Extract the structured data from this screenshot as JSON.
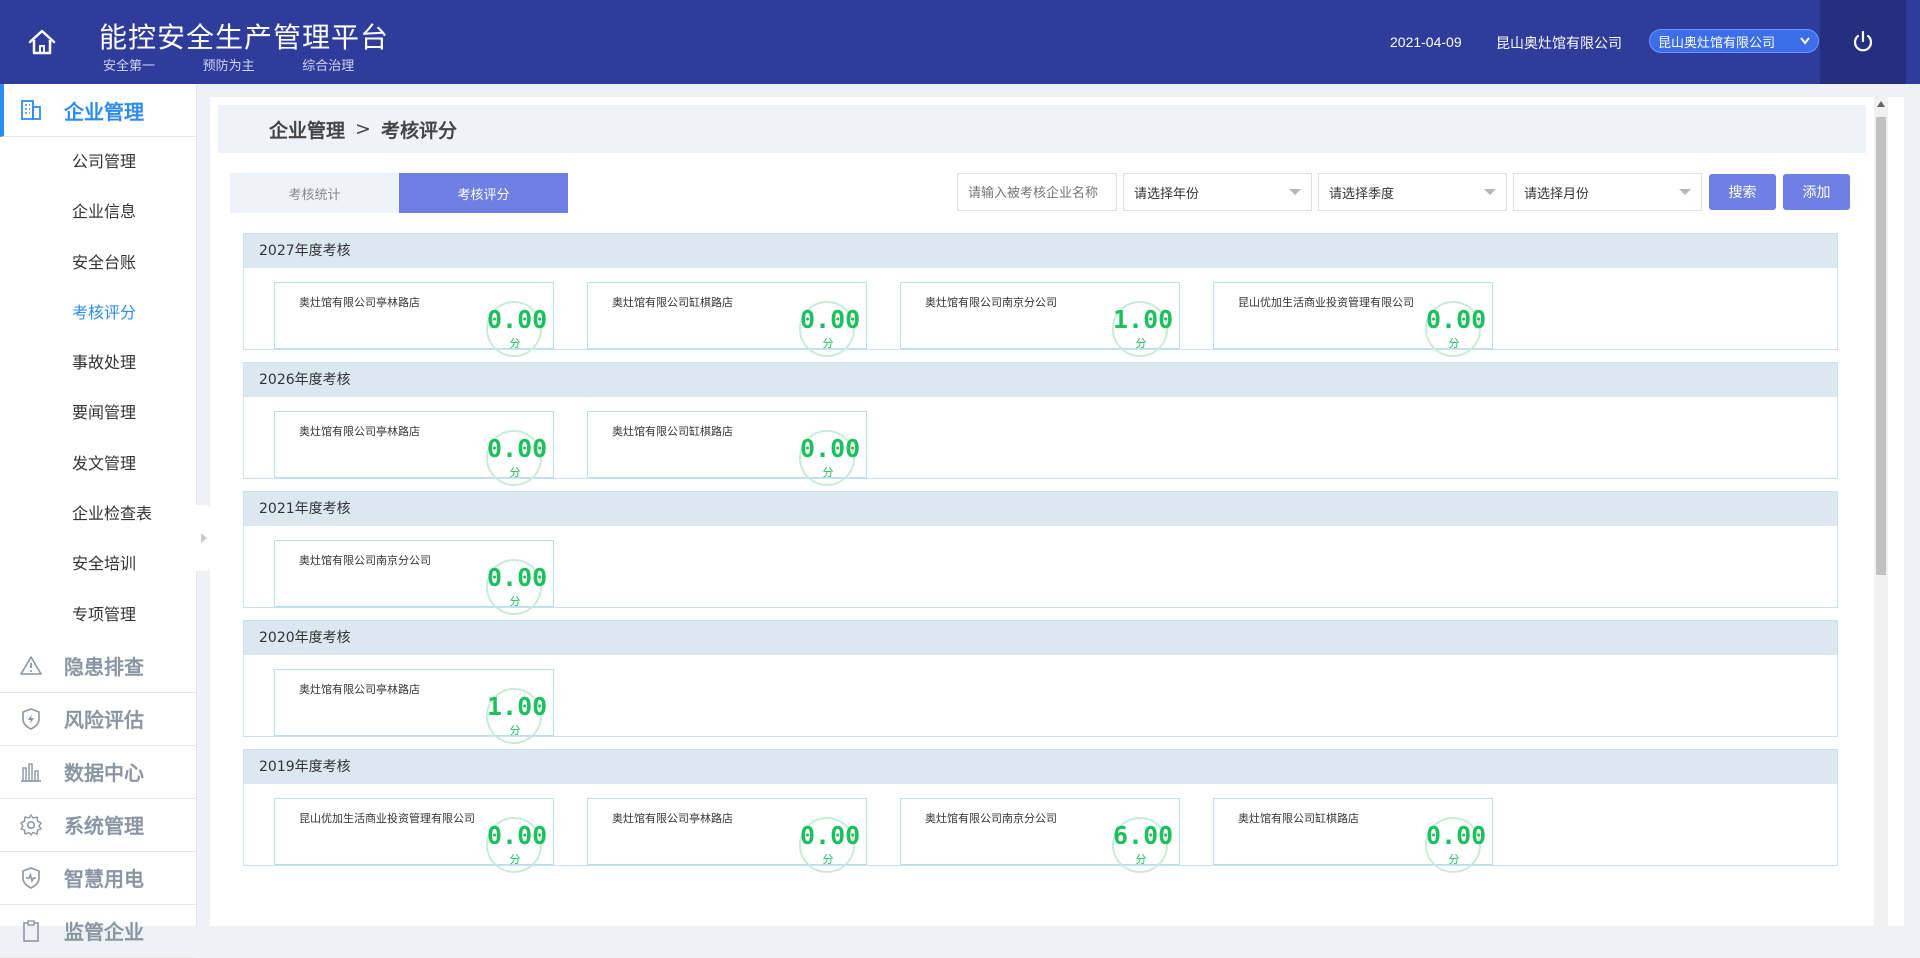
{
  "header": {
    "title": "能控安全生产管理平台",
    "slogans": [
      "安全第一",
      "预防为主",
      "综合治理"
    ],
    "date": "2021-04-09",
    "company": "昆山奥灶馆有限公司",
    "company_select": "昆山奥灶馆有限公司"
  },
  "sidebar": {
    "active_group": {
      "label": "企业管理",
      "icon": "building-icon"
    },
    "sub_items": [
      {
        "label": "公司管理"
      },
      {
        "label": "企业信息"
      },
      {
        "label": "安全台账"
      },
      {
        "label": "考核评分"
      },
      {
        "label": "事故处理"
      },
      {
        "label": "要闻管理"
      },
      {
        "label": "发文管理"
      },
      {
        "label": "企业检查表"
      },
      {
        "label": "安全培训"
      },
      {
        "label": "专项管理"
      }
    ],
    "groups": [
      {
        "label": "隐患排查",
        "icon": "warning-icon"
      },
      {
        "label": "风险评估",
        "icon": "shield-bolt-icon"
      },
      {
        "label": "数据中心",
        "icon": "bar-chart-icon"
      },
      {
        "label": "系统管理",
        "icon": "gear-icon"
      },
      {
        "label": "智慧用电",
        "icon": "shield-pulse-icon"
      },
      {
        "label": "监管企业",
        "icon": "clipboard-icon"
      }
    ]
  },
  "breadcrumb": {
    "parent": "企业管理",
    "separator": ">",
    "current": "考核评分"
  },
  "tabs": [
    {
      "label": "考核统计"
    },
    {
      "label": "考核评分"
    }
  ],
  "filters": {
    "search_placeholder": "请输入被考核企业名称",
    "year": "请选择年份",
    "quarter": "请选择季度",
    "month": "请选择月份",
    "search_button": "搜索",
    "add_button": "添加"
  },
  "unit": "分",
  "sections": [
    {
      "title": "2027年度考核",
      "cards": [
        {
          "name": "奥灶馆有限公司亭林路店",
          "score": "0.00"
        },
        {
          "name": "奥灶馆有限公司缸棋路店",
          "score": "0.00"
        },
        {
          "name": "奥灶馆有限公司南京分公司",
          "score": "1.00"
        },
        {
          "name": "昆山优加生活商业投资管理有限公司",
          "score": "0.00"
        }
      ]
    },
    {
      "title": "2026年度考核",
      "cards": [
        {
          "name": "奥灶馆有限公司亭林路店",
          "score": "0.00"
        },
        {
          "name": "奥灶馆有限公司缸棋路店",
          "score": "0.00"
        }
      ]
    },
    {
      "title": "2021年度考核",
      "cards": [
        {
          "name": "奥灶馆有限公司南京分公司",
          "score": "0.00"
        }
      ]
    },
    {
      "title": "2020年度考核",
      "cards": [
        {
          "name": "奥灶馆有限公司亭林路店",
          "score": "1.00"
        }
      ]
    },
    {
      "title": "2019年度考核",
      "cards": [
        {
          "name": "昆山优加生活商业投资管理有限公司",
          "score": "0.00"
        },
        {
          "name": "奥灶馆有限公司亭林路店",
          "score": "0.00"
        },
        {
          "name": "奥灶馆有限公司南京分公司",
          "score": "6.00"
        },
        {
          "name": "奥灶馆有限公司缸棋路店",
          "score": "0.00"
        }
      ]
    }
  ]
}
